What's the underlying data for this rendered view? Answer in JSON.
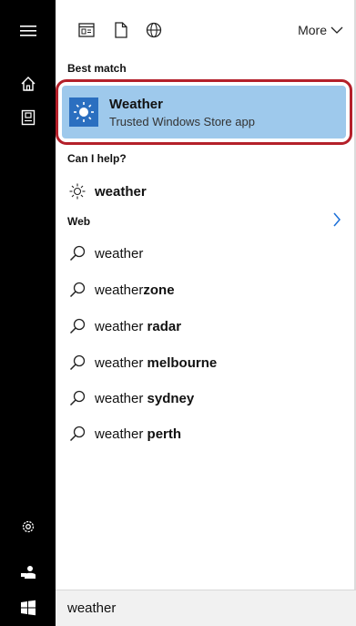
{
  "toolbar": {
    "icons": [
      "app-icon",
      "document-icon",
      "globe-icon"
    ],
    "more_label": "More"
  },
  "best_match": {
    "heading": "Best match",
    "app_name": "Weather",
    "app_subtitle": "Trusted Windows Store app"
  },
  "can_help": {
    "heading": "Can I help?",
    "item": "weather"
  },
  "web": {
    "heading": "Web",
    "suggestions": [
      {
        "prefix": "weather",
        "bold": ""
      },
      {
        "prefix": "weather",
        "bold": "zone"
      },
      {
        "prefix": "weather ",
        "bold": "radar"
      },
      {
        "prefix": "weather ",
        "bold": "melbourne"
      },
      {
        "prefix": "weather ",
        "bold": "sydney"
      },
      {
        "prefix": "weather ",
        "bold": "perth"
      }
    ]
  },
  "search": {
    "value": "weather"
  },
  "colors": {
    "rail_bg": "#000000",
    "highlight_bg": "#9ec9ec",
    "highlight_border": "#b4202a",
    "app_tile": "#2b6fc0",
    "chevron": "#1b6fd8"
  }
}
